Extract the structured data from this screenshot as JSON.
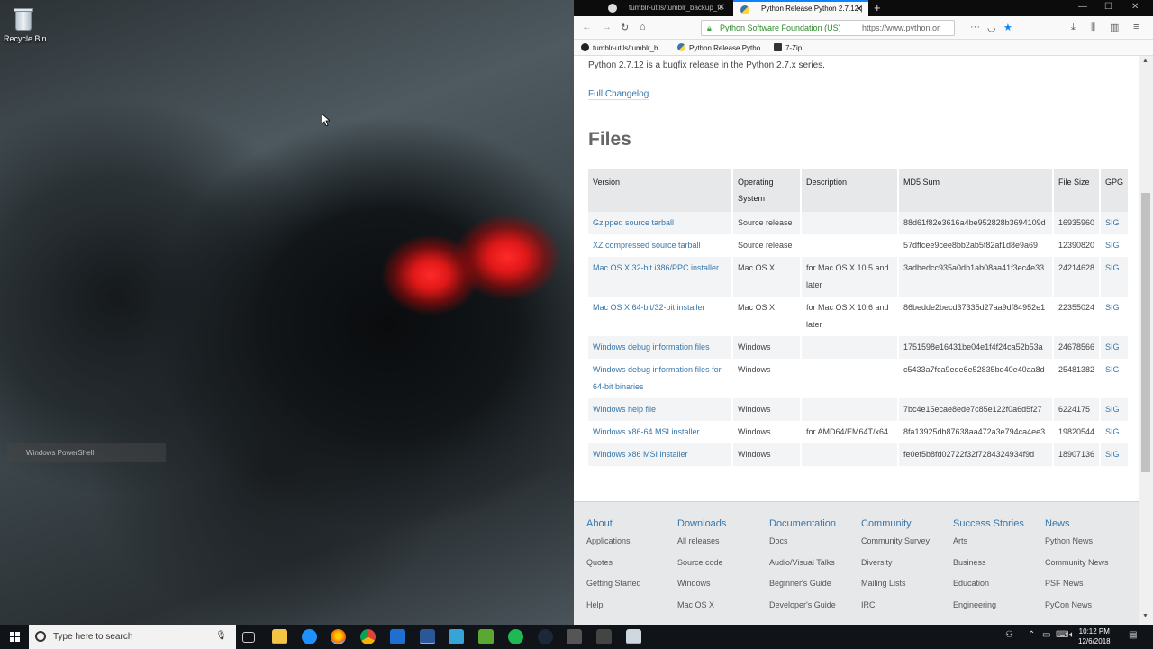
{
  "desktop": {
    "recycle_bin_label": "Recycle Bin",
    "powershell_tooltip": "Windows PowerShell"
  },
  "browser": {
    "tabs": [
      {
        "label": "tumblr-utils/tumblr_backup_fe",
        "icon": "github-icon"
      },
      {
        "label": "Python Release Python 2.7.12 |",
        "icon": "python-icon",
        "active": true
      }
    ],
    "new_tab": "+",
    "url": {
      "identity": "Python Software Foundation (US)",
      "text": "https://www.python.or"
    },
    "bookmarks": [
      {
        "label": "tumblr-utils/tumblr_b...",
        "icon": "github-icon"
      },
      {
        "label": "Python Release Pytho...",
        "icon": "python-icon"
      },
      {
        "label": "7-Zip",
        "icon": "7zip-icon"
      }
    ]
  },
  "page": {
    "intro": "Python 2.7.12 is a bugfix release in the Python 2.7.x series.",
    "changelog": "Full Changelog",
    "files_heading": "Files",
    "table": {
      "headers": [
        "Version",
        "Operating System",
        "Description",
        "MD5 Sum",
        "File Size",
        "GPG"
      ],
      "rows": [
        {
          "version": "Gzipped source tarball",
          "os": "Source release",
          "desc": "",
          "md5": "88d61f82e3616a4be952828b3694109d",
          "size": "16935960",
          "gpg": "SIG"
        },
        {
          "version": "XZ compressed source tarball",
          "os": "Source release",
          "desc": "",
          "md5": "57dffcee9cee8bb2ab5f82af1d8e9a69",
          "size": "12390820",
          "gpg": "SIG"
        },
        {
          "version": "Mac OS X 32-bit i386/PPC installer",
          "os": "Mac OS X",
          "desc": "for Mac OS X 10.5 and later",
          "md5": "3adbedcc935a0db1ab08aa41f3ec4e33",
          "size": "24214628",
          "gpg": "SIG"
        },
        {
          "version": "Mac OS X 64-bit/32-bit installer",
          "os": "Mac OS X",
          "desc": "for Mac OS X 10.6 and later",
          "md5": "86bedde2becd37335d27aa9df84952e1",
          "size": "22355024",
          "gpg": "SIG"
        },
        {
          "version": "Windows debug information files",
          "os": "Windows",
          "desc": "",
          "md5": "1751598e16431be04e1f4f24ca52b53a",
          "size": "24678566",
          "gpg": "SIG"
        },
        {
          "version": "Windows debug information files for 64-bit binaries",
          "os": "Windows",
          "desc": "",
          "md5": "c5433a7fca9ede6e52835bd40e40aa8d",
          "size": "25481382",
          "gpg": "SIG"
        },
        {
          "version": "Windows help file",
          "os": "Windows",
          "desc": "",
          "md5": "7bc4e15ecae8ede7c85e122f0a6d5f27",
          "size": "6224175",
          "gpg": "SIG"
        },
        {
          "version": "Windows x86-64 MSI installer",
          "os": "Windows",
          "desc": "for AMD64/EM64T/x64",
          "md5": "8fa13925db87638aa472a3e794ca4ee3",
          "size": "19820544",
          "gpg": "SIG"
        },
        {
          "version": "Windows x86 MSI installer",
          "os": "Windows",
          "desc": "",
          "md5": "fe0ef5b8fd02722f32f7284324934f9d",
          "size": "18907136",
          "gpg": "SIG"
        }
      ]
    },
    "footer": [
      {
        "heading": "About",
        "items": [
          "Applications",
          "Quotes",
          "Getting Started",
          "Help"
        ]
      },
      {
        "heading": "Downloads",
        "items": [
          "All releases",
          "Source code",
          "Windows",
          "Mac OS X"
        ]
      },
      {
        "heading": "Documentation",
        "items": [
          "Docs",
          "Audio/Visual Talks",
          "Beginner's Guide",
          "Developer's Guide"
        ]
      },
      {
        "heading": "Community",
        "items": [
          "Community Survey",
          "Diversity",
          "Mailing Lists",
          "IRC"
        ]
      },
      {
        "heading": "Success Stories",
        "items": [
          "Arts",
          "Business",
          "Education",
          "Engineering"
        ]
      },
      {
        "heading": "News",
        "items": [
          "Python News",
          "Community News",
          "PSF News",
          "PyCon News"
        ]
      }
    ]
  },
  "taskbar": {
    "search_placeholder": "Type here to search",
    "time": "10:12 PM",
    "date": "12/6/2018"
  },
  "colors": {
    "link": "#3776ab",
    "accent": "#0a84ff"
  }
}
